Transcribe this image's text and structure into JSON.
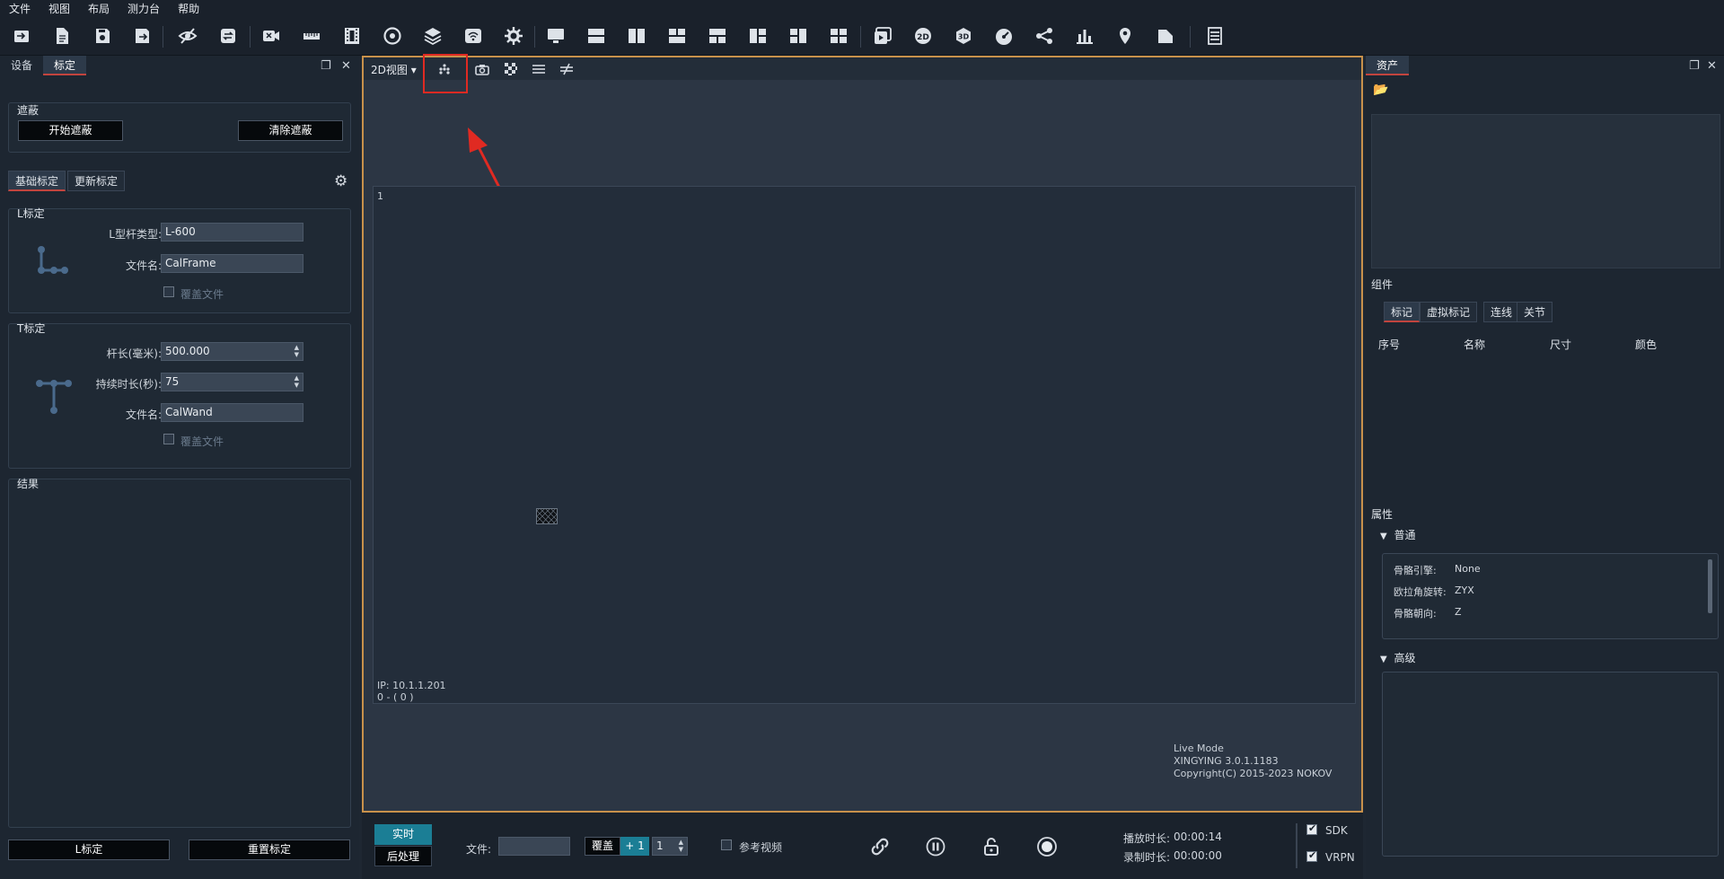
{
  "menu": [
    "文件",
    "视图",
    "布局",
    "测力台",
    "帮助"
  ],
  "toolbar_icons": [
    "open-icon",
    "new-file-icon",
    "save-icon",
    "save-as-icon",
    "hide-icon",
    "refresh-icon",
    "video-camera-icon",
    "ruler-icon",
    "film-icon",
    "disc-icon",
    "layers-icon",
    "wireless-icon",
    "settings-icon",
    "monitor-icon",
    "layout-1-icon",
    "layout-2-icon",
    "layout-3-icon",
    "layout-4-icon",
    "layout-5-icon",
    "layout-6-icon",
    "layout-7-icon",
    "play-video-icon",
    "2d-icon",
    "3d-icon",
    "gauge-icon",
    "graph-icon",
    "bar-chart-icon",
    "pin-icon",
    "document-icon",
    "list-icon"
  ],
  "left_panel": {
    "tabs": [
      "设备",
      "标定"
    ],
    "active_tab": "标定",
    "mask_group": {
      "title": "遮蔽",
      "start": "开始遮蔽",
      "clear": "清除遮蔽"
    },
    "sub_tabs": [
      "基础标定",
      "更新标定"
    ],
    "l_group": {
      "title": "L标定",
      "type_label": "L型杆类型:",
      "type_value": "L-600",
      "file_label": "文件名:",
      "file_value": "CalFrame",
      "overwrite": "覆盖文件"
    },
    "t_group": {
      "title": "T标定",
      "length_label": "杆长(毫米):",
      "length_value": "500.000",
      "duration_label": "持续时长(秒):",
      "duration_value": "75",
      "file_label": "文件名:",
      "file_value": "CalWand",
      "overwrite": "覆盖文件"
    },
    "result_title": "结果",
    "l_cal_button": "L标定",
    "reset_button": "重置标定"
  },
  "view": {
    "mode": "2D视图",
    "camera_index": "1",
    "ip": "IP: 10.1.1.201",
    "frame": "0 - ( 0 )",
    "live_mode": "Live Mode",
    "version": "XINGYING 3.0.1.1183",
    "copyright": "Copyright(C) 2015-2023 NOKOV"
  },
  "bottom": {
    "realtime": "实时",
    "post": "后处理",
    "file_label": "文件:",
    "overwrite": "覆盖",
    "plus": "+ 1",
    "count": "1",
    "ref_video": "参考视频",
    "play_time_label": "播放时长:",
    "play_time": "00:00:14",
    "rec_time_label": "录制时长:",
    "rec_time": "00:00:00",
    "sdk": "SDK",
    "vrpn": "VRPN"
  },
  "right_panel": {
    "tab": "资产",
    "components_title": "组件",
    "comp_tabs": [
      "标记",
      "虚拟标记",
      "连线",
      "关节"
    ],
    "columns": [
      "序号",
      "名称",
      "尺寸",
      "颜色"
    ],
    "properties_title": "属性",
    "general": "普通",
    "props": [
      {
        "k": "骨骼引擎:",
        "v": "None"
      },
      {
        "k": "欧拉角旋转:",
        "v": "ZYX"
      },
      {
        "k": "骨骼朝向:",
        "v": "Z"
      }
    ],
    "advanced": "高级"
  }
}
